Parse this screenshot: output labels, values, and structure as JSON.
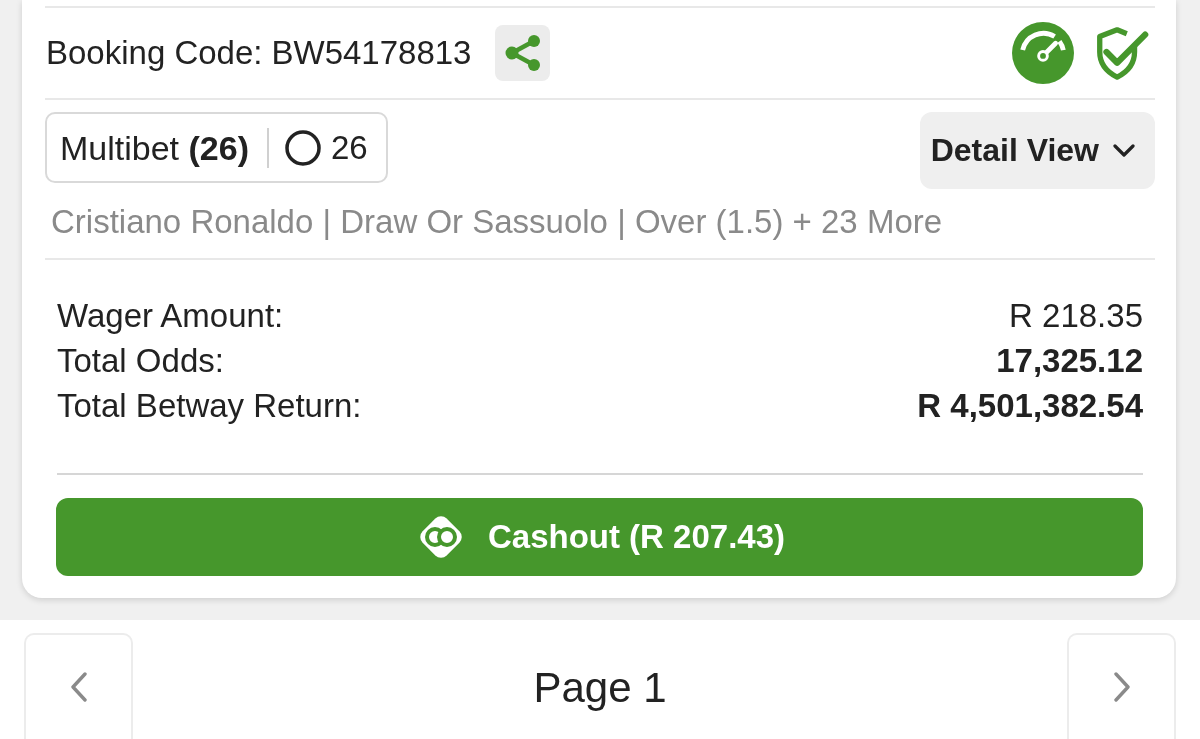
{
  "booking": {
    "label": "Booking Code:",
    "code": "BW54178813"
  },
  "bet": {
    "type": "Multibet **(26)**",
    "legs": "26"
  },
  "detail_button": {
    "label": "Detail View"
  },
  "selections": "Cristiano Ronaldo | Draw Or Sassuolo | Over (1.5) + 23 More",
  "summary": [
    {
      "label": "Wager Amount:",
      "value": "R 218.35",
      "bold": false
    },
    {
      "label": "Total Odds:",
      "value": "17,325.12",
      "bold": true
    },
    {
      "label": "Total Betway Return:",
      "value": "R 4,501,382.54",
      "bold": true
    }
  ],
  "cashout_button": {
    "label": "Cashout (R 207.43)"
  },
  "pagination": {
    "label": "Page 1"
  }
}
